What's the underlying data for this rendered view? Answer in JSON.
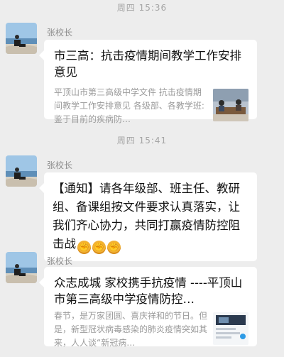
{
  "messages": [
    {
      "timestamp": "周四 15:36",
      "sender": "张校长",
      "title": "市三高：抗击疫情期间教学工作安排意见",
      "desc": "平顶山市第三高级中学文件  抗击疫情期间教学工作安排意见  各级部、各教学班:鉴于目前的疾病防…"
    },
    {
      "timestamp": "周四 15:41",
      "sender": "张校长",
      "text": "【通知】请各年级部、班主任、教研组、备课组按文件要求认真落实，让我们齐心协力，共同打赢疫情防控阻击战",
      "emoji": [
        "fist-emoji",
        "fist-emoji",
        "fist-emoji"
      ]
    },
    {
      "sender": "张校长",
      "title": "众志成城 家校携手抗疫情 ----平顶山市第三高级中学疫情防控…",
      "desc": "春节，是万家团圆、喜庆祥和的节日。但是，新型冠状病毒感染的肺炎疫情突如其来，人人谈“新冠病…"
    }
  ]
}
